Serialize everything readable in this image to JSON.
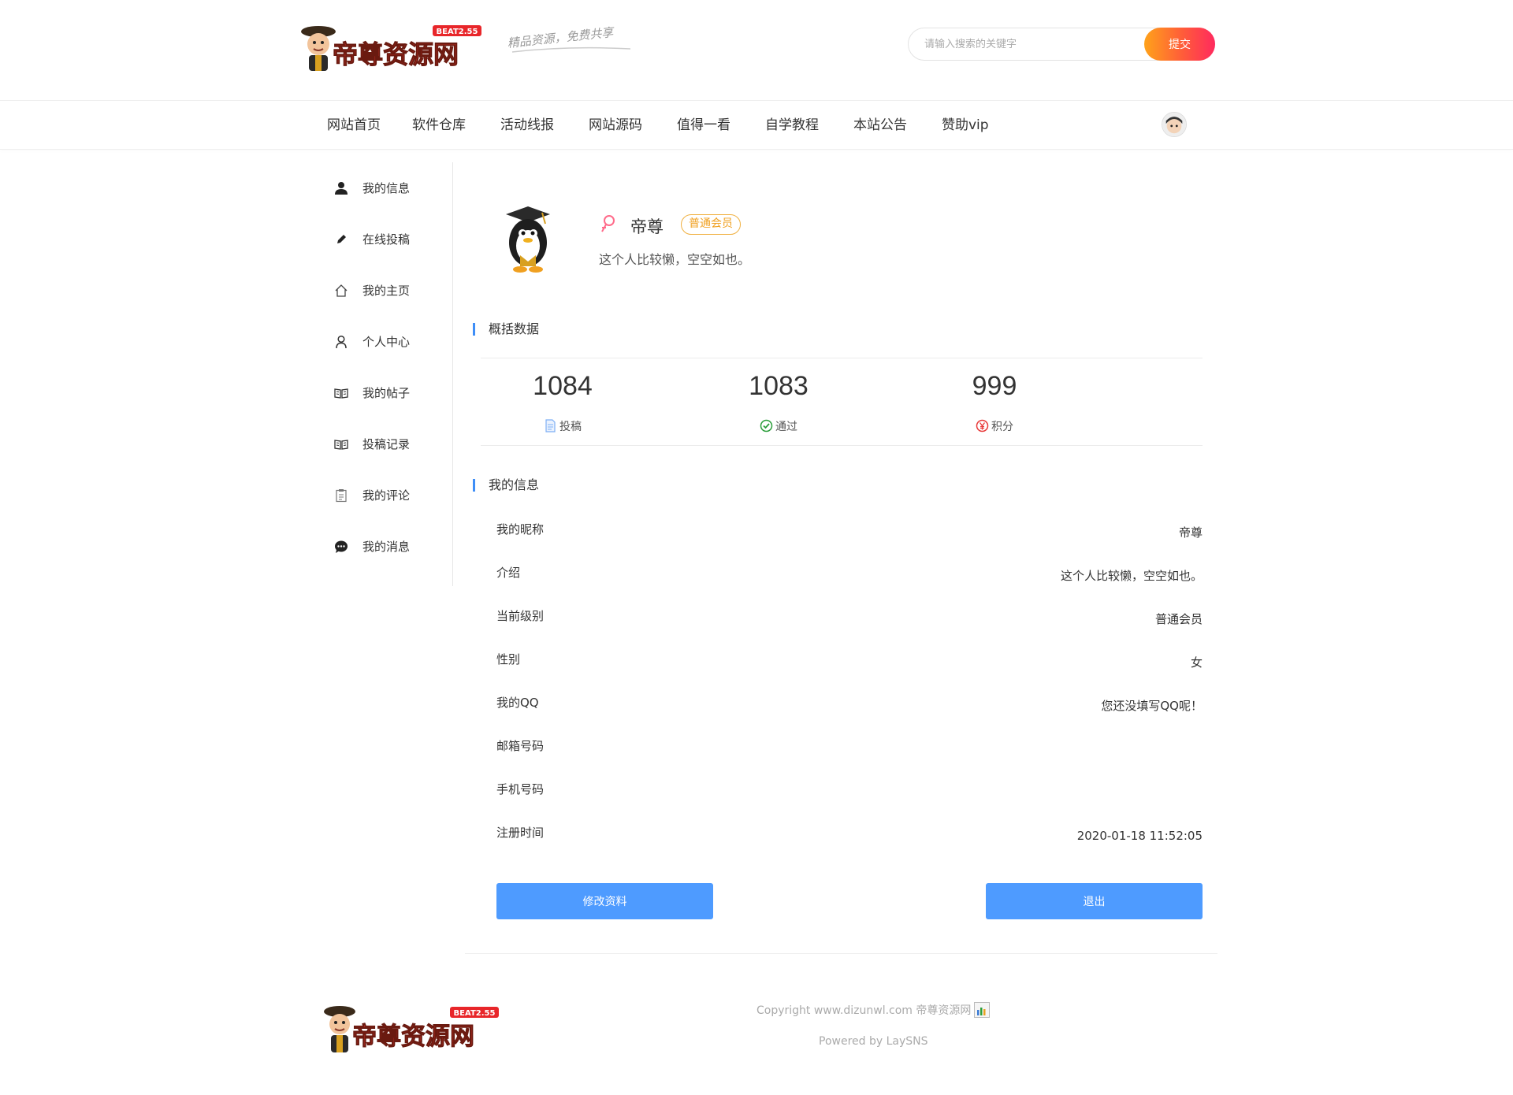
{
  "colors": {
    "accent": "#3e8ef7",
    "button": "#4e9bff",
    "search_gradient_start": "#ffa21a",
    "search_gradient_end": "#ff2a5e",
    "badge": "#f0a020"
  },
  "header": {
    "logo_text": "帝尊资源网",
    "logo_version": "BEAT2.55",
    "slogan": "精品资源，免费共享",
    "search_placeholder": "请输入搜索的关键字",
    "search_button": "提交"
  },
  "nav": {
    "items": [
      "网站首页",
      "软件仓库",
      "活动线报",
      "网站源码",
      "值得一看",
      "自学教程",
      "本站公告",
      "赞助vip"
    ],
    "avatar_icon": "user-avatar-icon"
  },
  "sidebar": {
    "items": [
      {
        "label": "我的信息",
        "icon": "user-solid-icon"
      },
      {
        "label": "在线投稿",
        "icon": "pencil-icon"
      },
      {
        "label": "我的主页",
        "icon": "home-icon"
      },
      {
        "label": "个人中心",
        "icon": "user-outline-icon"
      },
      {
        "label": "我的帖子",
        "icon": "book-icon"
      },
      {
        "label": "投稿记录",
        "icon": "book-icon"
      },
      {
        "label": "我的评论",
        "icon": "clipboard-icon"
      },
      {
        "label": "我的消息",
        "icon": "chat-icon"
      }
    ]
  },
  "profile": {
    "name": "帝尊",
    "level": "普通会员",
    "intro": "这个人比较懒，空空如也。",
    "gender_icon": "female-icon"
  },
  "overview": {
    "title": "概括数据",
    "stats": [
      {
        "value": "1084",
        "label": "投稿",
        "icon": "document-icon",
        "color": "#7fb0f5"
      },
      {
        "value": "1083",
        "label": "通过",
        "icon": "check-circle-icon",
        "color": "#2a9d3a"
      },
      {
        "value": "999",
        "label": "积分",
        "icon": "yen-circle-icon",
        "color": "#e83a3a"
      }
    ]
  },
  "info": {
    "title": "我的信息",
    "rows": [
      {
        "key": "我的昵称",
        "value": "帝尊"
      },
      {
        "key": "介绍",
        "value": "这个人比较懒，空空如也。"
      },
      {
        "key": "当前级别",
        "value": "普通会员"
      },
      {
        "key": "性别",
        "value": "女"
      },
      {
        "key": "我的QQ",
        "value": "您还没填写QQ呢！"
      },
      {
        "key": "邮箱号码",
        "value": ""
      },
      {
        "key": "手机号码",
        "value": ""
      },
      {
        "key": "注册时间",
        "value": "2020-01-18 11:52:05"
      }
    ]
  },
  "actions": {
    "edit": "修改资料",
    "logout": "退出"
  },
  "footer": {
    "copyright": "Copyright www.dizunwl.com 帝尊资源网",
    "powered": "Powered by LaySNS"
  }
}
